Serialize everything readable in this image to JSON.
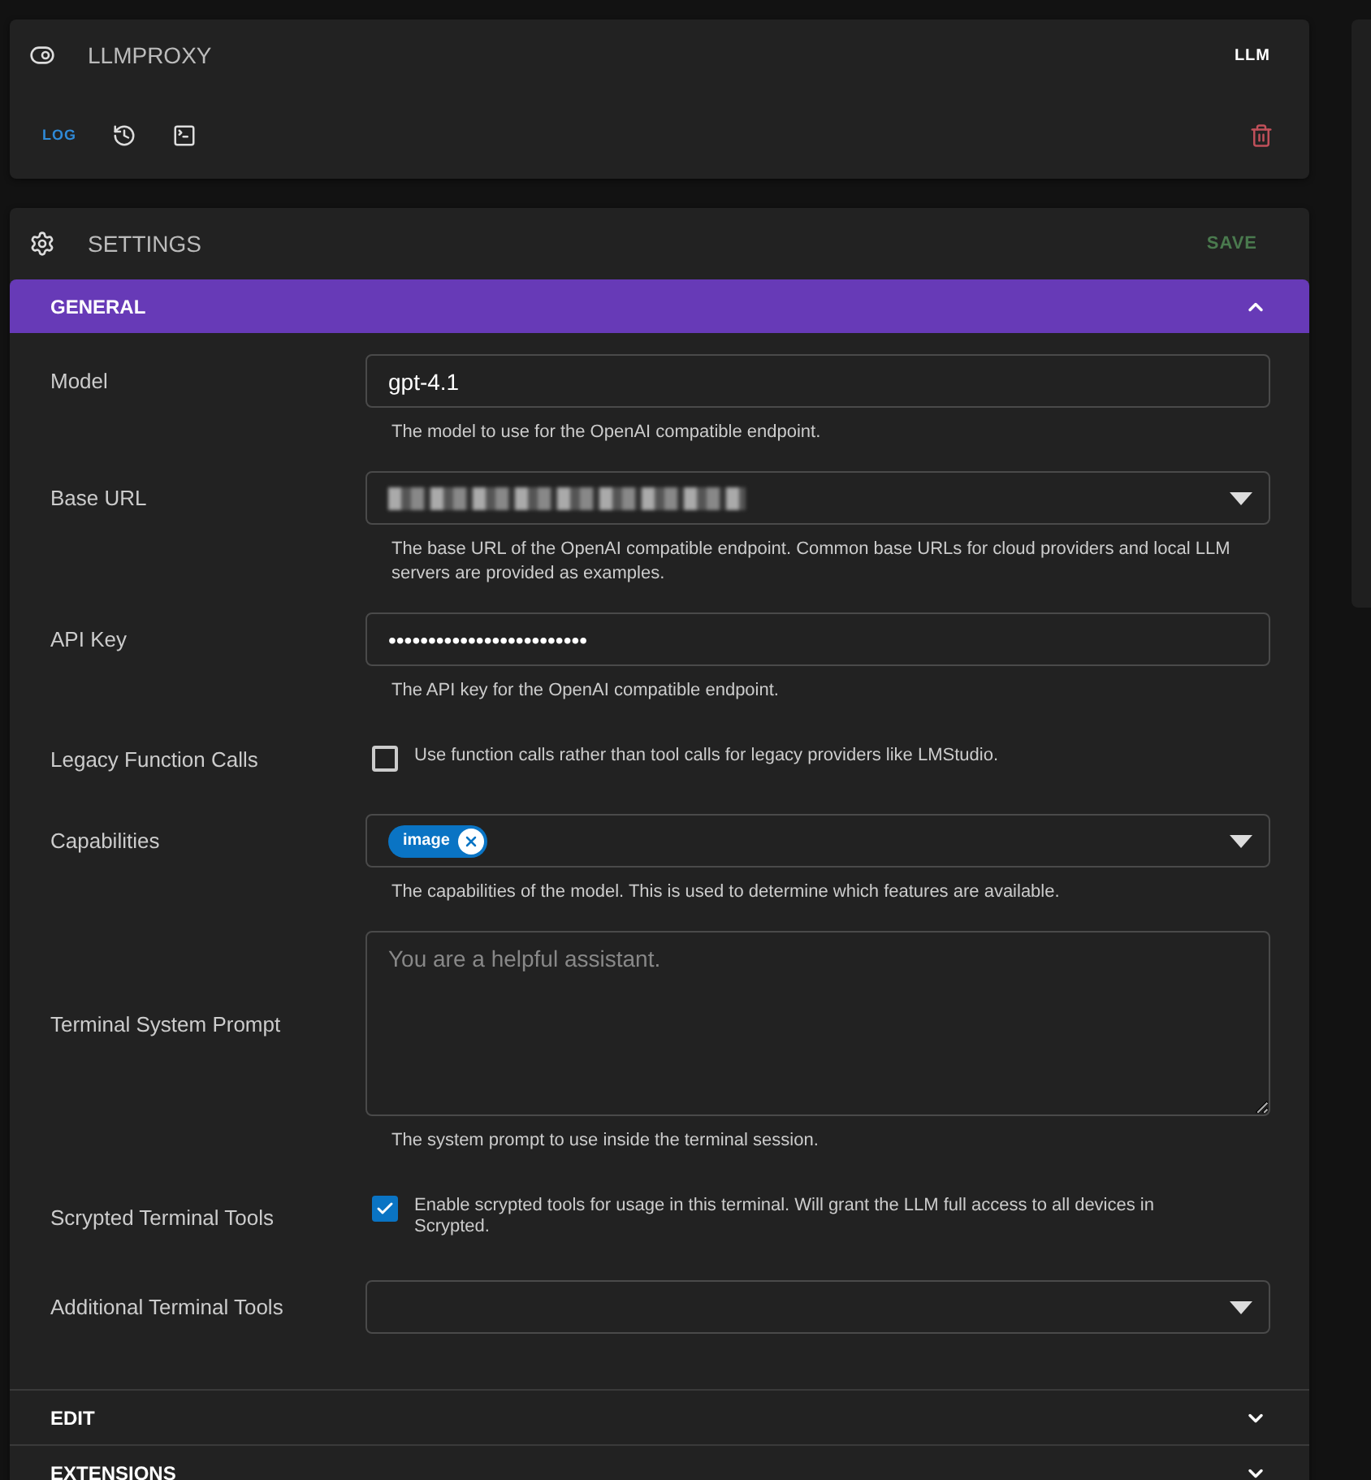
{
  "plugin_card": {
    "title": "LLMPROXY",
    "badge": "LLM",
    "actions": [
      {
        "kind": "text",
        "label": "LOG",
        "selected": true
      },
      {
        "kind": "history"
      },
      {
        "kind": "terminal"
      },
      {
        "kind": "delete"
      }
    ]
  },
  "settings": {
    "title": "SETTINGS",
    "save_label": "SAVE",
    "save_disabled": true,
    "sections": [
      {
        "title": "GENERAL",
        "expanded": true,
        "fields": [
          {
            "kind": "text",
            "label": "Model",
            "value": "gpt-4.1",
            "help": "The model to use for the OpenAI compatible endpoint."
          },
          {
            "kind": "select",
            "label": "Base URL",
            "redacted": true,
            "help": "The base URL of the OpenAI compatible endpoint. Common base URLs for cloud providers and local LLM servers are provided as examples."
          },
          {
            "kind": "password",
            "label": "API Key",
            "value": "•••••••••••••••••••••••••",
            "help": "The API key for the OpenAI compatible endpoint."
          },
          {
            "kind": "checkbox",
            "label": "Legacy Function Calls",
            "checked": false,
            "help": "Use function calls rather than tool calls for legacy providers like LMStudio."
          },
          {
            "kind": "chips",
            "label": "Capabilities",
            "chips": [
              "image"
            ],
            "help": "The capabilities of the model. This is used to determine which features are available."
          },
          {
            "kind": "textarea",
            "label": "Terminal System Prompt",
            "placeholder": "You are a helpful assistant.",
            "help": "The system prompt to use inside the terminal session."
          },
          {
            "kind": "checkbox",
            "label": "Scrypted Terminal Tools",
            "checked": true,
            "help": "Enable scrypted tools for usage in this terminal. Will grant the LLM full access to all devices in Scrypted."
          },
          {
            "kind": "select",
            "label": "Additional Terminal Tools",
            "redacted": false
          }
        ]
      },
      {
        "title": "EDIT",
        "expanded": false
      },
      {
        "title": "EXTENSIONS",
        "expanded": false
      }
    ]
  }
}
